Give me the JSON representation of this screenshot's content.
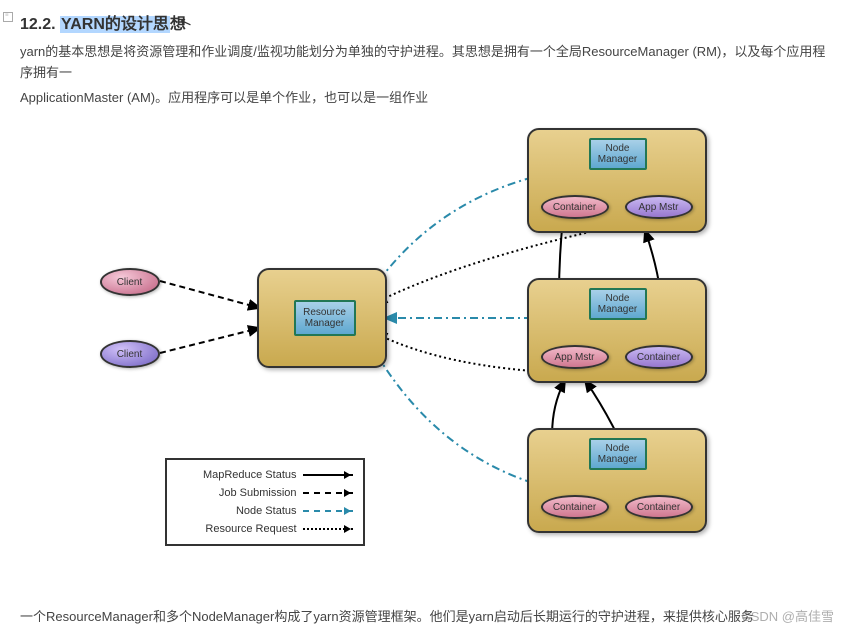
{
  "heading": {
    "number": "12.2.",
    "highlighted": "YARN的设计思",
    "rest": "想"
  },
  "intro_para": "yarn的基本思想是将资源管理和作业调度/监视功能划分为单独的守护进程。其思想是拥有一个全局ResourceManager (RM)，以及每个应用程序拥有一",
  "intro_para2": "ApplicationMaster (AM)。应用程序可以是单个作业，也可以是一组作业",
  "diagram": {
    "client1": "Client",
    "client2": "Client",
    "resource_manager": "Resource\nManager",
    "nm1": {
      "nm": "Node\nManager",
      "container": "Container",
      "appmstr": "App Mstr"
    },
    "nm2": {
      "nm": "Node\nManager",
      "appmstr": "App Mstr",
      "container": "Container"
    },
    "nm3": {
      "nm": "Node\nManager",
      "container1": "Container",
      "container2": "Container"
    }
  },
  "legend": {
    "mapreduce": "MapReduce Status",
    "job": "Job Submission",
    "node": "Node Status",
    "resource": "Resource Request"
  },
  "footer": "一个ResourceManager和多个NodeManager构成了yarn资源管理框架。他们是yarn启动后长期运行的守护进程，来提供核心服务",
  "watermark": "CSDN @高佳雪"
}
